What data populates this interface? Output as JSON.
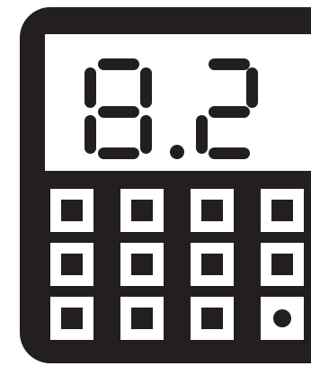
{
  "display": {
    "reading": "8.2",
    "digits": [
      "8",
      "2"
    ]
  },
  "keypad": {
    "rows": 3,
    "columns": 4,
    "last_key_marker": "dot"
  },
  "colors": {
    "body": "#231f20",
    "screen": "#ffffff",
    "segment": "#231f20",
    "key_face": "#ffffff",
    "key_center": "#231f20"
  }
}
